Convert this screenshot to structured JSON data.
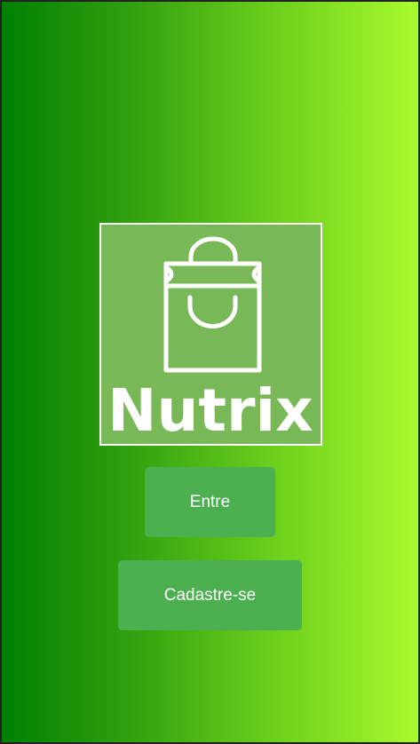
{
  "logo": {
    "text": "Nutrix",
    "icon": "shopping-bag-icon"
  },
  "buttons": {
    "login": "Entre",
    "signup": "Cadastre-se"
  },
  "colors": {
    "gradient_start": "#008000",
    "gradient_end": "#a8fa2e",
    "button": "#4caf50",
    "logo_bg": "#78b856"
  }
}
